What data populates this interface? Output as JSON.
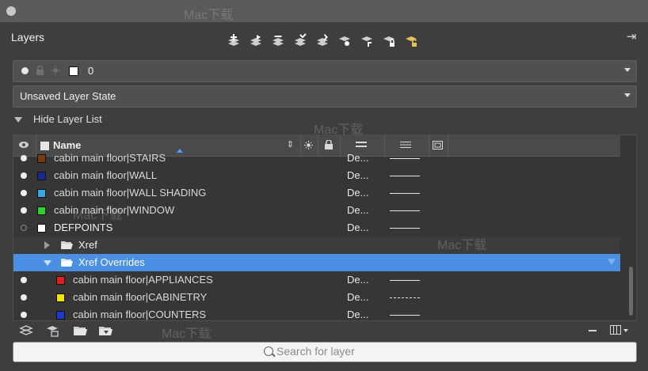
{
  "panel": {
    "title": "Layers"
  },
  "current_layer": {
    "name": "0",
    "swatch_color": "#ffffff"
  },
  "layer_state": {
    "label": "Unsaved Layer State"
  },
  "layer_list_toggle": {
    "label": "Hide Layer List"
  },
  "grid": {
    "header": {
      "name": "Name"
    },
    "rows": [
      {
        "name": "cabin main floor|STAIRS",
        "color": "De...",
        "swatch": "#7a3a10",
        "linetype": "continuous",
        "visible": true,
        "type": "layer"
      },
      {
        "name": "cabin main floor|WALL",
        "color": "De...",
        "swatch": "#1a2a8a",
        "linetype": "continuous",
        "visible": true,
        "type": "layer"
      },
      {
        "name": "cabin main floor|WALL SHADING",
        "color": "De...",
        "swatch": "#36a9e1",
        "linetype": "continuous",
        "visible": true,
        "type": "layer"
      },
      {
        "name": "cabin main floor|WINDOW",
        "color": "De...",
        "swatch": "#2ed12e",
        "linetype": "continuous",
        "visible": true,
        "type": "layer"
      },
      {
        "name": "DEFPOINTS",
        "color": "De...",
        "swatch": "#ffffff",
        "linetype": "continuous",
        "visible": false,
        "type": "layer"
      },
      {
        "name": "Xref",
        "type": "group"
      },
      {
        "name": "Xref Overrides",
        "type": "group-selected"
      },
      {
        "name": "cabin main floor|APPLIANCES",
        "color": "De...",
        "swatch": "#e02020",
        "linetype": "continuous",
        "visible": true,
        "type": "sublayer"
      },
      {
        "name": "cabin main floor|CABINETRY",
        "color": "De...",
        "swatch": "#f2e600",
        "linetype": "dotted",
        "visible": true,
        "type": "sublayer"
      },
      {
        "name": "cabin main floor|COUNTERS",
        "color": "De...",
        "swatch": "#2038d0",
        "linetype": "continuous",
        "visible": true,
        "type": "sublayer"
      }
    ]
  },
  "search": {
    "placeholder": "Search for layer"
  },
  "watermark": {
    "text": "Mac下载"
  },
  "icons": {
    "toolbar": [
      "new-layer-icon",
      "new-layer-vp-frozen-icon",
      "delete-layer-icon",
      "set-current-icon",
      "layer-properties-icon",
      "layer-isolate-icon",
      "layer-freeze-icon",
      "layer-lock-icon",
      "layer-unlock-icon"
    ],
    "bottom": [
      "layer-filter-icon",
      "layer-manager-icon",
      "new-group-filter-icon",
      "new-property-filter-icon"
    ]
  }
}
